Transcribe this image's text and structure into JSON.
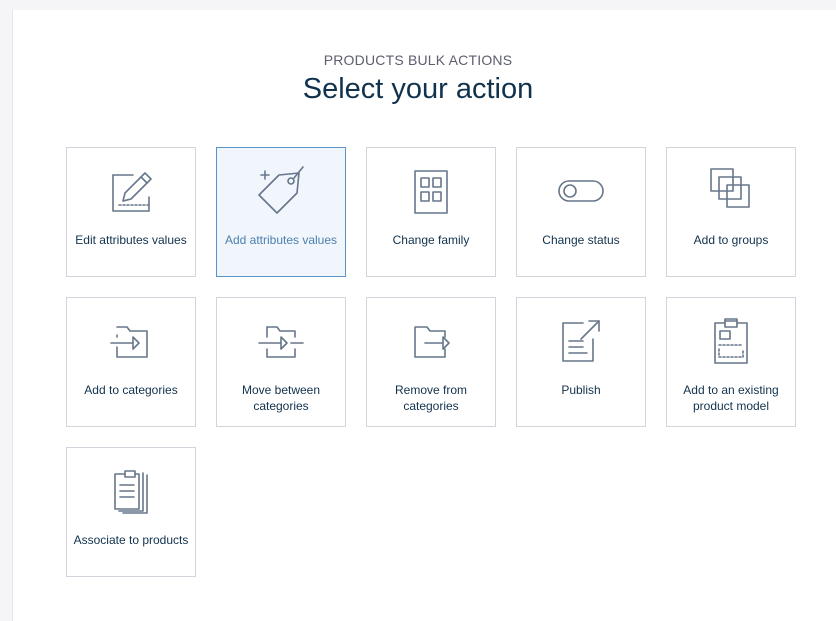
{
  "page": {
    "subtitle": "PRODUCTS BULK ACTIONS",
    "title": "Select your action"
  },
  "colors": {
    "selected_border": "#5992c7",
    "selected_background": "#f0f6fc",
    "icon": "#67768a",
    "text": "#11324d"
  },
  "actions": [
    {
      "label": "Edit attributes values",
      "icon": "edit-attributes-icon",
      "selected": false
    },
    {
      "label": "Add attributes values",
      "icon": "tag-plus-icon",
      "selected": true
    },
    {
      "label": "Change family",
      "icon": "family-grid-icon",
      "selected": false
    },
    {
      "label": "Change status",
      "icon": "toggle-icon",
      "selected": false
    },
    {
      "label": "Add to groups",
      "icon": "groups-icon",
      "selected": false
    },
    {
      "label": "Add to categories",
      "icon": "folder-add-icon",
      "selected": false
    },
    {
      "label": "Move between categories",
      "icon": "folder-move-icon",
      "selected": false
    },
    {
      "label": "Remove from categories",
      "icon": "folder-remove-icon",
      "selected": false
    },
    {
      "label": "Publish",
      "icon": "publish-icon",
      "selected": false
    },
    {
      "label": "Add to an existing product model",
      "icon": "clipboard-model-icon",
      "selected": false
    },
    {
      "label": "Associate to products",
      "icon": "associate-documents-icon",
      "selected": false
    }
  ]
}
